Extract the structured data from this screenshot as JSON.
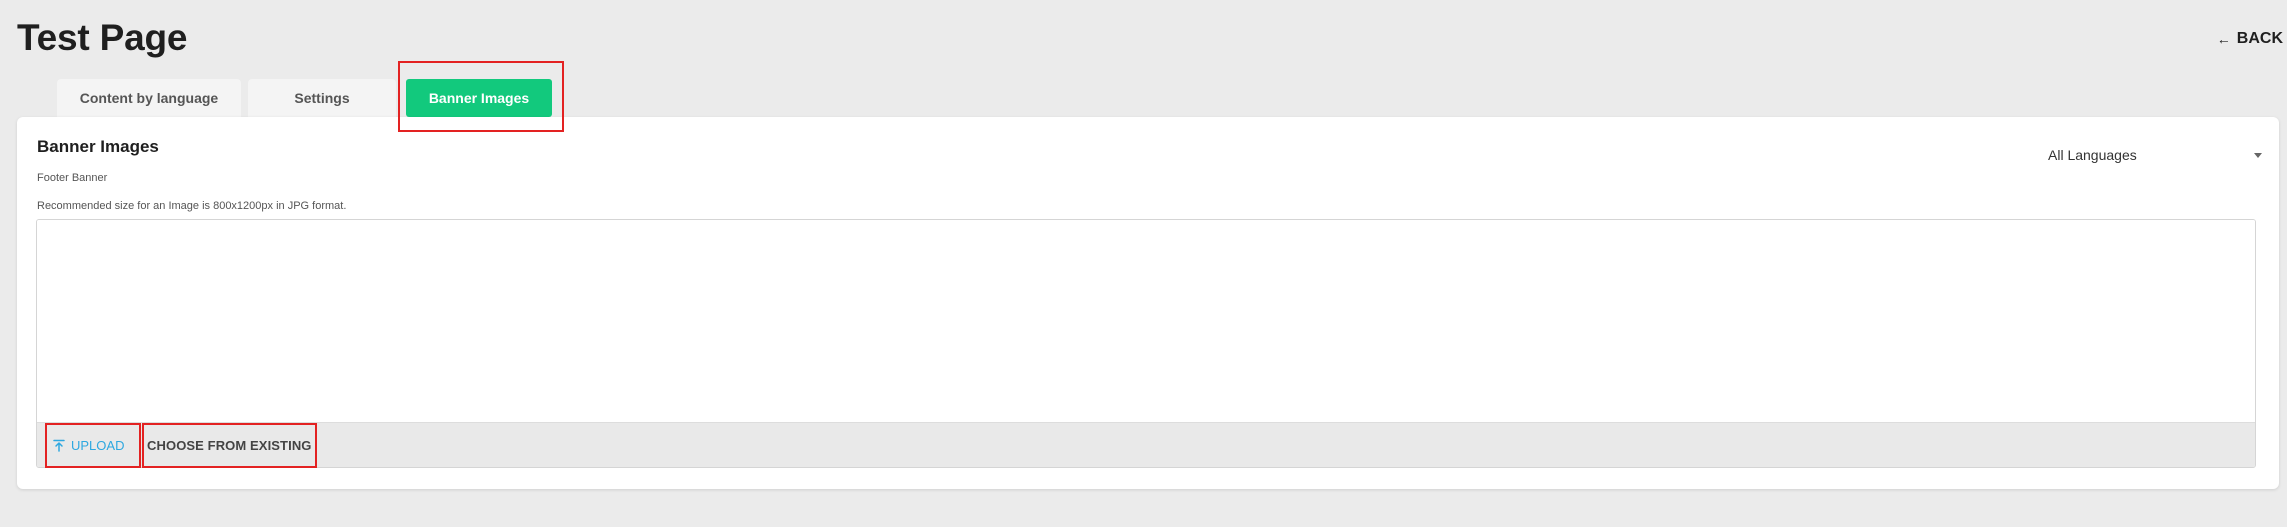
{
  "page": {
    "title": "Test Page",
    "back_label": "BACK"
  },
  "tabs": [
    {
      "label": "Content by language",
      "active": false
    },
    {
      "label": "Settings",
      "active": false
    },
    {
      "label": "Banner Images",
      "active": true
    }
  ],
  "card": {
    "title": "Banner Images",
    "section_label": "Footer Banner",
    "help_text": "Recommended size for an Image is 800x1200px in JPG format.",
    "language_select": {
      "value": "All Languages",
      "icon": "chevron-down-icon"
    },
    "actions": {
      "upload_label": "UPLOAD",
      "upload_icon": "upload-icon",
      "choose_label": "CHOOSE FROM EXISTING"
    }
  },
  "colors": {
    "background": "#ebebeb",
    "active_tab": "#12c97d",
    "upload_link": "#2ea8e0",
    "highlight_box": "#e32222"
  }
}
